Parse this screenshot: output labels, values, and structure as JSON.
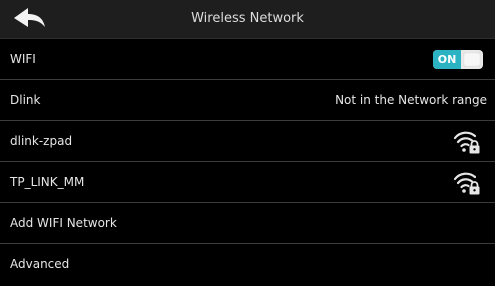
{
  "header": {
    "title": "Wireless Network",
    "back_icon": "back-arrow-icon"
  },
  "rows": [
    {
      "label": "WIFI",
      "toggle_label": "ON",
      "toggle_on": true
    },
    {
      "label": "Dlink",
      "status": "Not in the Network range"
    },
    {
      "label": "dlink-zpad",
      "icon": "wifi-lock-icon"
    },
    {
      "label": "TP_LINK_MM",
      "icon": "wifi-lock-icon"
    },
    {
      "label": "Add WIFI Network"
    },
    {
      "label": "Advanced"
    }
  ],
  "colors": {
    "background": "#000000",
    "header": "#1e1e1e",
    "toggle_on": "#2bb3c4",
    "divider": "#3c3c3c"
  }
}
